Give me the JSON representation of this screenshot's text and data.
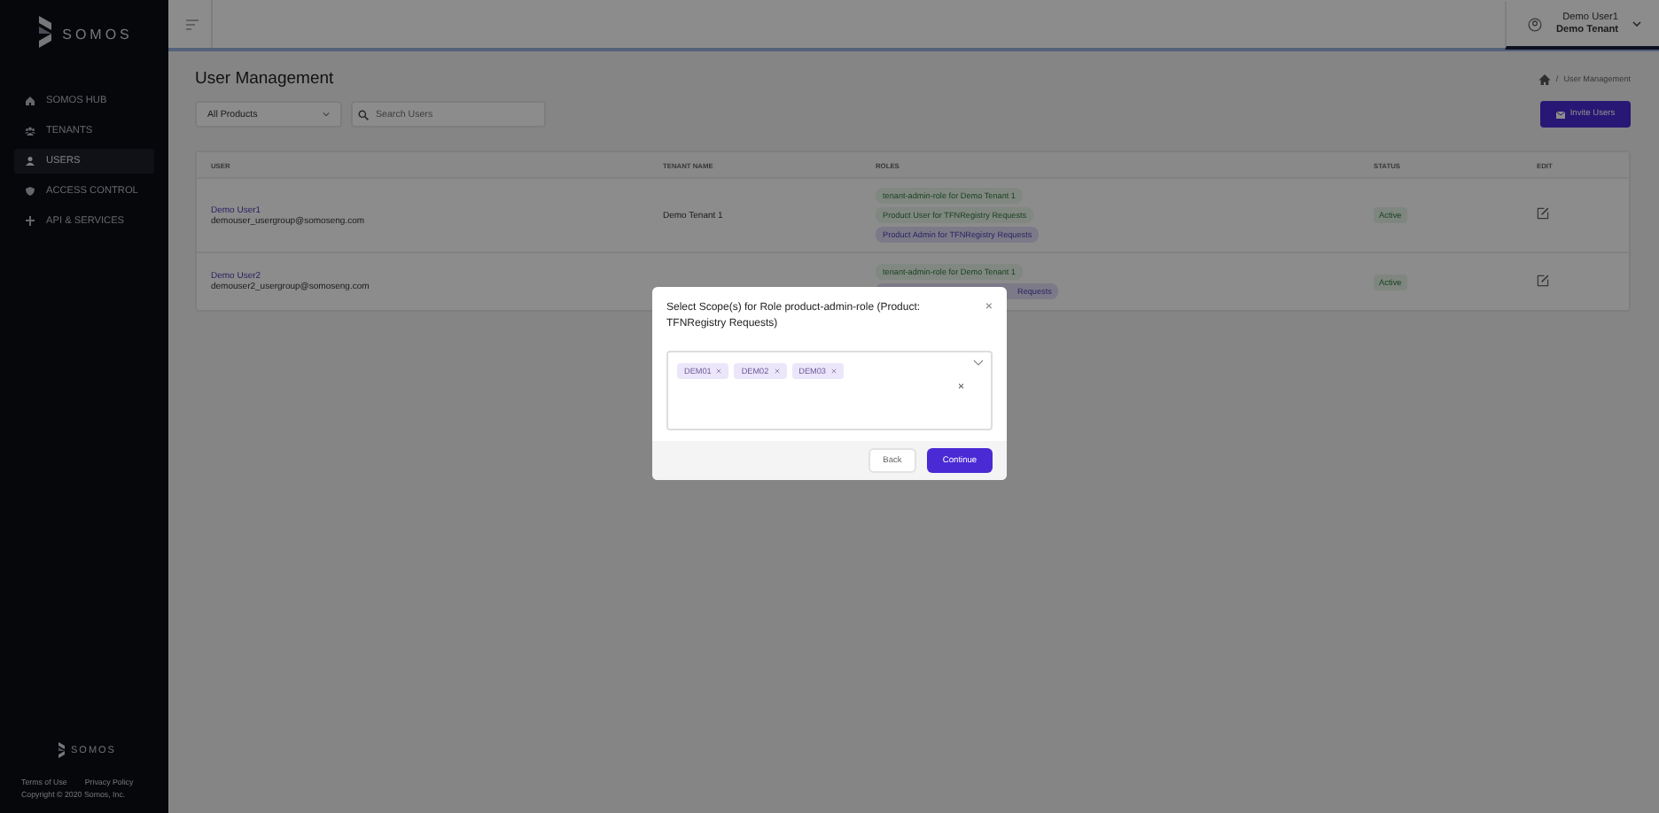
{
  "sidebar": {
    "logo": "SOMOS",
    "nav": [
      {
        "label": "SOMOS HUB",
        "selected": false
      },
      {
        "label": "TENANTS",
        "selected": false
      },
      {
        "label": "USERS",
        "selected": true
      },
      {
        "label": "ACCESS CONTROL",
        "selected": false
      },
      {
        "label": "API & SERVICES",
        "selected": false
      }
    ],
    "footer_logo": "SOMOS",
    "footer_links": [
      "Terms of Use",
      "Privacy Policy"
    ],
    "copyright": "Copyright © 2020 Somos, Inc."
  },
  "header": {
    "user_name": "Demo User1",
    "tenant": "Demo Tenant"
  },
  "page": {
    "title": "User Management",
    "breadcrumb_separator": "/",
    "breadcrumb": "User Management",
    "product_filter": "All Products",
    "search": {
      "placeholder": "Search Users"
    },
    "invite_button": "Invite Users"
  },
  "table": {
    "columns": [
      "USER",
      "TENANT NAME",
      "ROLES",
      "STATUS",
      "EDIT"
    ],
    "rows": [
      {
        "name": "Demo User1",
        "email": "demouser_usergroup@somoseng.com",
        "tenant": "Demo Tenant 1",
        "roles": [
          {
            "label": "tenant-admin-role for Demo Tenant 1",
            "kind": "tag"
          },
          {
            "label": "Product User for TFNRegistry Requests",
            "kind": "tag"
          },
          {
            "label": "Product Admin for TFNRegistry Requests",
            "kind": "chip"
          }
        ],
        "status": "Active"
      },
      {
        "name": "Demo User2",
        "email": "demouser2_usergroup@somoseng.com",
        "roles": [
          {
            "label": "tenant-admin-role for Demo Tenant 1",
            "kind": "tag"
          },
          {
            "label": "Requests",
            "kind": "chip",
            "covered": true
          }
        ],
        "status": "Active"
      }
    ]
  },
  "modal": {
    "title": "Select Scope(s) for Role product-admin-role (Product: TFNRegistry Requests)",
    "close": "×",
    "scopes": [
      "DEM01",
      "DEM02",
      "DEM03"
    ],
    "clear": "×",
    "back_button": "Back",
    "continue_button": "Continue"
  }
}
